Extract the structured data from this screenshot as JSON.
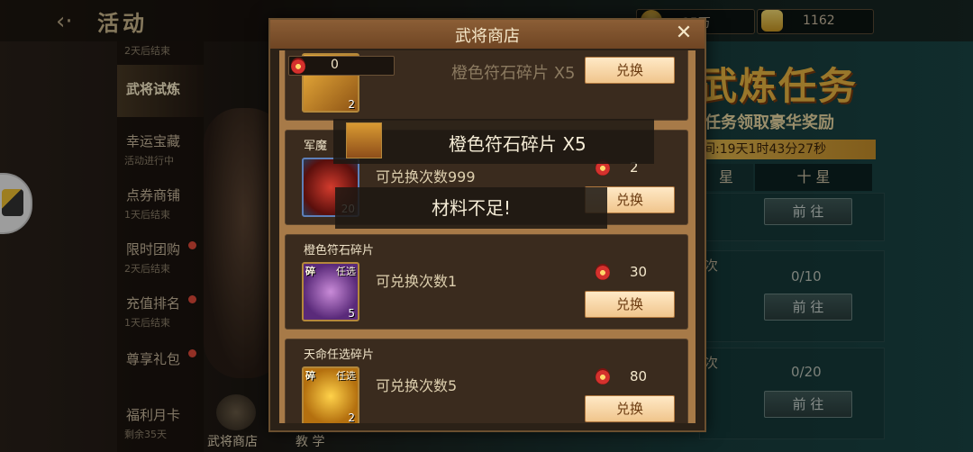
{
  "header": {
    "back_icon": "back-arrow-icon",
    "title": "活动"
  },
  "currency": [
    {
      "icon": "gold-coin-icon",
      "value": "15万"
    },
    {
      "icon": "gold-ingot-icon",
      "value": "1162"
    }
  ],
  "sidebar": {
    "items": [
      {
        "label": "",
        "sub": "2天后结束",
        "dot": false
      },
      {
        "label": "武将试炼",
        "sub": "",
        "dot": false,
        "active": true
      },
      {
        "label": "幸运宝藏",
        "sub": "活动进行中",
        "dot": false
      },
      {
        "label": "点券商铺",
        "sub": "1天后结束",
        "dot": false
      },
      {
        "label": "限时团购",
        "sub": "2天后结束",
        "dot": true
      },
      {
        "label": "充值排名",
        "sub": "1天后结束",
        "dot": true
      },
      {
        "label": "尊享礼包",
        "sub": "",
        "dot": true
      },
      {
        "label": "福利月卡",
        "sub": "剩余35天",
        "dot": false
      }
    ]
  },
  "bottom_nav": {
    "shop_label": "武将商店",
    "tutorial_label": "教 学"
  },
  "event": {
    "title": "武炼任务",
    "subtitle": "任务领取豪华奖励",
    "timer": "间:19天1时43分27秒",
    "tabs": [
      "星",
      "十 星"
    ],
    "rows": [
      {
        "progress": "",
        "action": "前 往"
      },
      {
        "prefix": "次",
        "progress": "0/10",
        "action": "前 往"
      },
      {
        "prefix": "次",
        "progress": "0/20",
        "action": "前 往"
      }
    ]
  },
  "dialog": {
    "title": "武将商店",
    "close_icon": "close-icon",
    "currency_icon": "red-gem-icon",
    "currency_value": "0",
    "items": [
      {
        "name": "",
        "faded_label": "橙色符石碎片 X5",
        "count_label": "",
        "qty": "2",
        "price": "",
        "button": "兑换"
      },
      {
        "name": "军魔",
        "count_label": "可兑换次数999",
        "qty": "20",
        "price": "2",
        "button": "兑换"
      },
      {
        "name": "橙色符石碎片",
        "count_label": "可兑换次数1",
        "qty": "5",
        "price": "30",
        "button": "兑换",
        "tag1": "碎",
        "tag2": "任选"
      },
      {
        "name": "天命任选碎片",
        "count_label": "可兑换次数5",
        "qty": "2",
        "price": "80",
        "button": "兑换",
        "tag1": "碎",
        "tag2": "任选"
      }
    ]
  },
  "toasts": {
    "item_toast": "橙色符石碎片 X5",
    "message_toast": "材料不足!"
  }
}
